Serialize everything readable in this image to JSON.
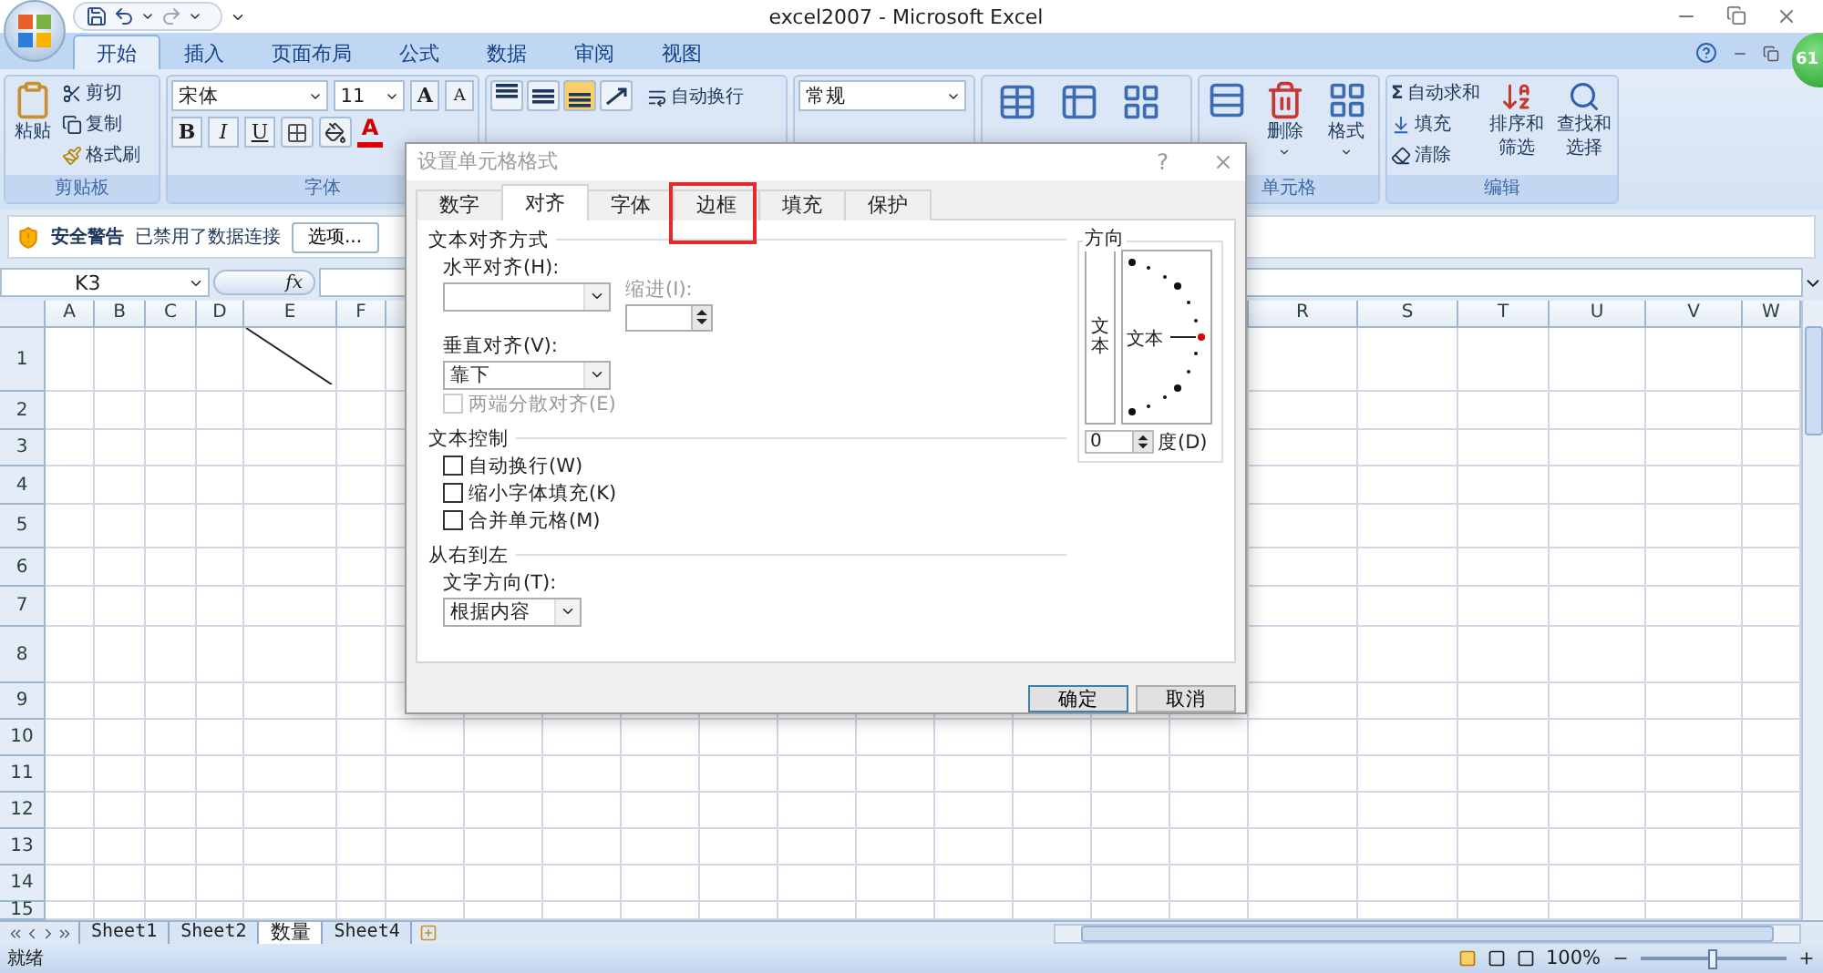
{
  "window": {
    "title": "excel2007 - Microsoft Excel"
  },
  "ribbon_tabs": [
    {
      "label": "开始",
      "selected": true
    },
    {
      "label": "插入",
      "selected": false
    },
    {
      "label": "页面布局",
      "selected": false
    },
    {
      "label": "公式",
      "selected": false
    },
    {
      "label": "数据",
      "selected": false
    },
    {
      "label": "审阅",
      "selected": false
    },
    {
      "label": "视图",
      "selected": false
    }
  ],
  "ribbon": {
    "clipboard": {
      "label": "剪贴板",
      "paste": "粘贴",
      "cut": "剪切",
      "copy": "复制",
      "format_painter": "格式刷"
    },
    "font": {
      "label": "字体",
      "font_name": "宋体",
      "font_size": "11",
      "bold": "B",
      "italic": "I",
      "underline": "U",
      "grow": "A",
      "shrink": "A",
      "font_color": "A"
    },
    "alignment": {
      "wrap_text": "自动换行"
    },
    "number": {
      "format": "常规"
    },
    "cells": {
      "label": "单元格",
      "buttons": [
        "删除",
        "格式"
      ]
    },
    "editing": {
      "label": "编辑",
      "autosum_symbol": "Σ",
      "autosum": "自动求和",
      "fill": "填充",
      "clear": "清除",
      "sort_filter": [
        "排序和",
        "筛选"
      ],
      "find_select": [
        "查找和",
        "选择"
      ]
    }
  },
  "security_bar": {
    "title": "安全警告",
    "message": "已禁用了数据连接",
    "button": "选项..."
  },
  "formula_bar": {
    "name_box": "K3",
    "function_label": "fx"
  },
  "sheet": {
    "columns_left": [
      "A",
      "B",
      "C",
      "D",
      "E",
      "F"
    ],
    "columns_right": [
      "R",
      "S",
      "T",
      "U",
      "V",
      "W"
    ],
    "rows": [
      "1",
      "2",
      "3",
      "4",
      "5",
      "6",
      "7",
      "8",
      "9",
      "10",
      "11",
      "12",
      "13",
      "14",
      "15"
    ]
  },
  "sheet_tabs": [
    {
      "label": "Sheet1",
      "selected": false
    },
    {
      "label": "Sheet2",
      "selected": false
    },
    {
      "label": "数量",
      "selected": true
    },
    {
      "label": "Sheet4",
      "selected": false
    }
  ],
  "status_bar": {
    "status": "就绪",
    "zoom": "100%",
    "zoom_slider": {
      "level": 0.5
    }
  },
  "badge": "61",
  "dialog": {
    "title": "设置单元格格式",
    "help": "?",
    "tabs": [
      {
        "label": "数字",
        "selected": false,
        "highlighted": false
      },
      {
        "label": "对齐",
        "selected": true,
        "highlighted": false
      },
      {
        "label": "字体",
        "selected": false,
        "highlighted": false
      },
      {
        "label": "边框",
        "selected": false,
        "highlighted": true
      },
      {
        "label": "填充",
        "selected": false,
        "highlighted": false
      },
      {
        "label": "保护",
        "selected": false,
        "highlighted": false
      }
    ],
    "text_alignment": {
      "heading": "文本对齐方式",
      "horizontal_label": "水平对齐(H):",
      "indent_label": "缩进(I):",
      "vertical_label": "垂直对齐(V):",
      "vertical_value": "靠下",
      "justify_distributed": {
        "label": "两端分散对齐(E)",
        "checked": false,
        "disabled": true
      }
    },
    "text_control": {
      "heading": "文本控制",
      "options": [
        {
          "label": "自动换行(W)",
          "checked": false
        },
        {
          "label": "缩小字体填充(K)",
          "checked": false
        },
        {
          "label": "合并单元格(M)",
          "checked": false
        }
      ]
    },
    "rtl": {
      "heading": "从右到左",
      "direction_label": "文字方向(T):",
      "direction_value": "根据内容"
    },
    "orientation": {
      "heading": "方向",
      "vertical_text": "文本",
      "dial_text": "文本",
      "degrees": "0",
      "degrees_label": "度(D)"
    },
    "buttons": [
      {
        "label": "确定",
        "default": true
      },
      {
        "label": "取消",
        "default": false
      }
    ]
  }
}
